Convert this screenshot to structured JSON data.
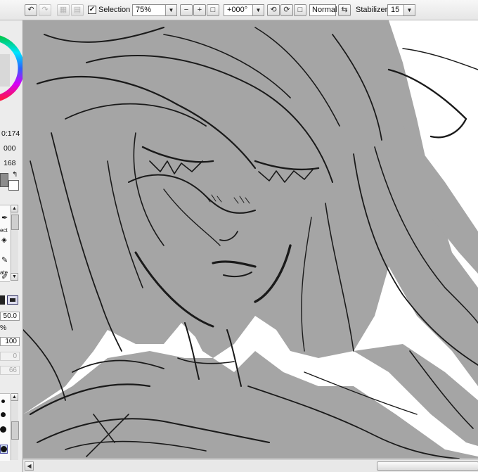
{
  "toolbar": {
    "undo_icon": "↶",
    "redo_icon": "↷",
    "deselect_icon": "▦",
    "invert_icon": "▤",
    "selection_label": "Selection",
    "selection_checked": "✓",
    "zoom_value": "75%",
    "zoom_out_icon": "−",
    "zoom_in_icon": "+",
    "zoom_reset_icon": "□",
    "rotation_value": "+000°",
    "rotate_left_icon": "⟲",
    "rotate_right_icon": "⟳",
    "rotate_reset_icon": "□",
    "view_mode": "Normal",
    "flip_icon": "⇆",
    "stabilizer_label": "Stabilizer",
    "stabilizer_value": "15",
    "dropdown_arrow": "▼"
  },
  "left_panel": {
    "hsv_fragment_1": "0:174",
    "hsv_fragment_2": "000",
    "hsv_fragment_3": "168",
    "tool_fragment_1": "ect",
    "tool_fragment_2": "ate",
    "size_value": "50.0",
    "percent_symbol": "%",
    "density_value": "100",
    "min_size_value": "0",
    "min_density_value": "66",
    "scroll_up": "▲",
    "scroll_down": "▼"
  },
  "scrollbar": {
    "left_arrow": "◀"
  },
  "colors": {
    "primary_swatch": "#8c8c8c",
    "secondary_swatch": "#ffffff",
    "line_art": "#1a1a1a",
    "fill_gray": "#a5a5a5"
  }
}
